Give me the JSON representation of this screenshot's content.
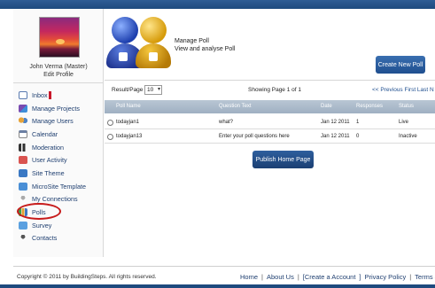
{
  "user": {
    "name": "John Verma (Master)",
    "edit_profile": "Edit Profile"
  },
  "sidebar": {
    "items": [
      {
        "label": "Inbox",
        "icon": "inbox-icon"
      },
      {
        "label": "Manage Projects",
        "icon": "projects-icon"
      },
      {
        "label": "Manage Users",
        "icon": "users-icon"
      },
      {
        "label": "Calendar",
        "icon": "calendar-icon"
      },
      {
        "label": "Moderation",
        "icon": "moderation-icon"
      },
      {
        "label": "User Activity",
        "icon": "activity-icon"
      },
      {
        "label": "Site Theme",
        "icon": "theme-icon"
      },
      {
        "label": "MicroSite Template",
        "icon": "microsite-icon"
      },
      {
        "label": "My Connections",
        "icon": "connections-icon"
      },
      {
        "label": "Polls",
        "icon": "polls-icon"
      },
      {
        "label": "Survey",
        "icon": "survey-icon"
      },
      {
        "label": "Contacts",
        "icon": "contacts-icon"
      }
    ],
    "highlight_color": "#c71b1b"
  },
  "header": {
    "title": "Manage Poll",
    "subtitle": "View and analyse Poll",
    "create_button": "Create New Poll"
  },
  "pager": {
    "result_label": "Result/Page",
    "per_page": "10",
    "showing": "Showing Page 1 of 1",
    "nav": "<< Previous  First  Last  N"
  },
  "table": {
    "columns": [
      "Poll Name",
      "Question Text",
      "Date",
      "Responses",
      "Status"
    ],
    "rows": [
      {
        "name": "todayjan1",
        "question": "what?",
        "date": "Jan 12 2011",
        "responses": "1",
        "status": "Live"
      },
      {
        "name": "todayjan13",
        "question": "Enter your poll questions here",
        "date": "Jan 12 2011",
        "responses": "0",
        "status": "Inactive"
      }
    ]
  },
  "publish_button": "Publish Home Page",
  "footer": {
    "copyright": "Copyright © 2011 by BuildingSteps. All rights reserved.",
    "links": [
      "Home",
      "About Us",
      "Create a Account",
      "Privacy Policy",
      "Terms &"
    ]
  },
  "colors": {
    "brand": "#1e4a7e",
    "button": "#2f5f9e",
    "table_header": "#a9b8c8"
  }
}
